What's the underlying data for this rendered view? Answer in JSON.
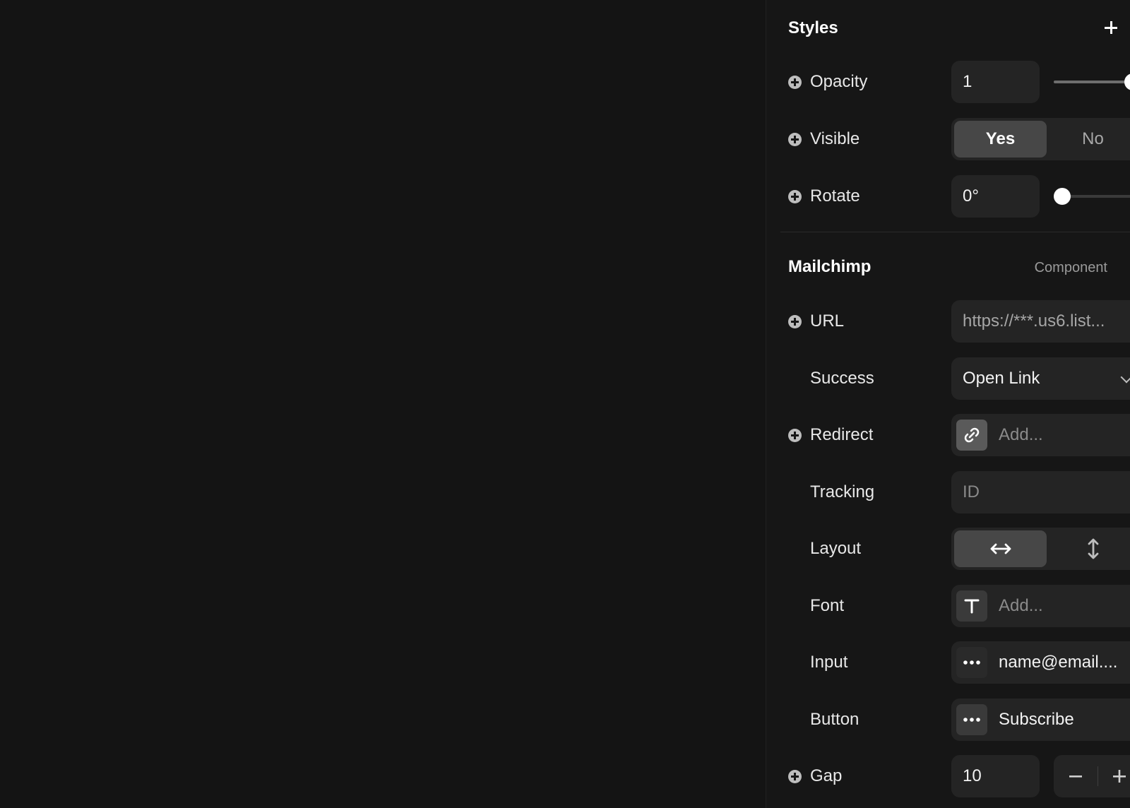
{
  "styles": {
    "title": "Styles",
    "opacity": {
      "label": "Opacity",
      "value": "1",
      "slider_level": 1.0
    },
    "visible": {
      "label": "Visible",
      "options": [
        "Yes",
        "No"
      ],
      "selected": "Yes"
    },
    "rotate": {
      "label": "Rotate",
      "value": "0°",
      "slider_level": 0.0
    }
  },
  "mailchimp": {
    "title": "Mailchimp",
    "tag": "Component",
    "url": {
      "label": "URL",
      "value": "https://***.us6.list..."
    },
    "success": {
      "label": "Success",
      "value": "Open Link"
    },
    "redirect": {
      "label": "Redirect",
      "placeholder": "Add..."
    },
    "tracking": {
      "label": "Tracking",
      "placeholder": "ID"
    },
    "layout": {
      "label": "Layout",
      "selected": "horizontal"
    },
    "font": {
      "label": "Font",
      "placeholder": "Add..."
    },
    "input": {
      "label": "Input",
      "value": "name@email...."
    },
    "button": {
      "label": "Button",
      "value": "Subscribe"
    },
    "gap": {
      "label": "Gap",
      "value": "10"
    }
  },
  "icons": {
    "add": "plus-icon",
    "row_add": "plus-circle-icon",
    "dropdown": "chevron-down-icon",
    "redirect": "link-icon",
    "layout_horizontal": "arrows-horizontal-icon",
    "layout_vertical": "arrows-vertical-icon",
    "font": "text-icon",
    "more": "more-dots-icon",
    "decrement": "minus-icon",
    "increment": "plus-icon"
  }
}
